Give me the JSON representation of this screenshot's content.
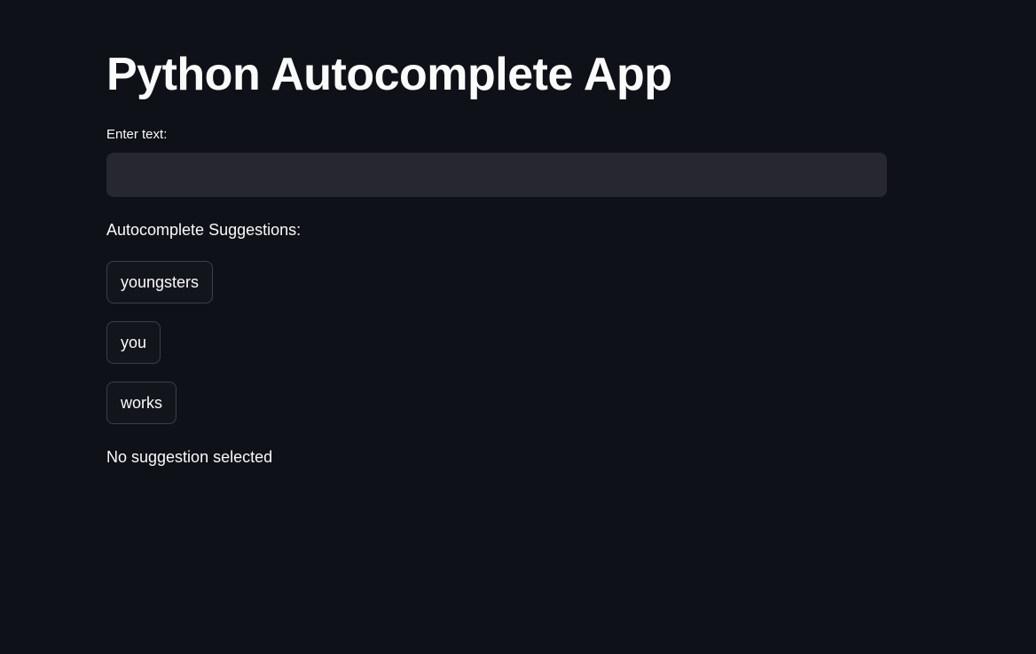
{
  "app": {
    "title": "Python Autocomplete App"
  },
  "input": {
    "label": "Enter text:",
    "value": "",
    "placeholder": ""
  },
  "suggestions": {
    "heading": "Autocomplete Suggestions:",
    "items": [
      {
        "label": "youngsters"
      },
      {
        "label": "you"
      },
      {
        "label": "works"
      }
    ]
  },
  "status": {
    "text": "No suggestion selected"
  },
  "colors": {
    "background": "#0e1117",
    "input_background": "#262730",
    "button_border": "#3d3f4a",
    "text": "#fafafa"
  }
}
